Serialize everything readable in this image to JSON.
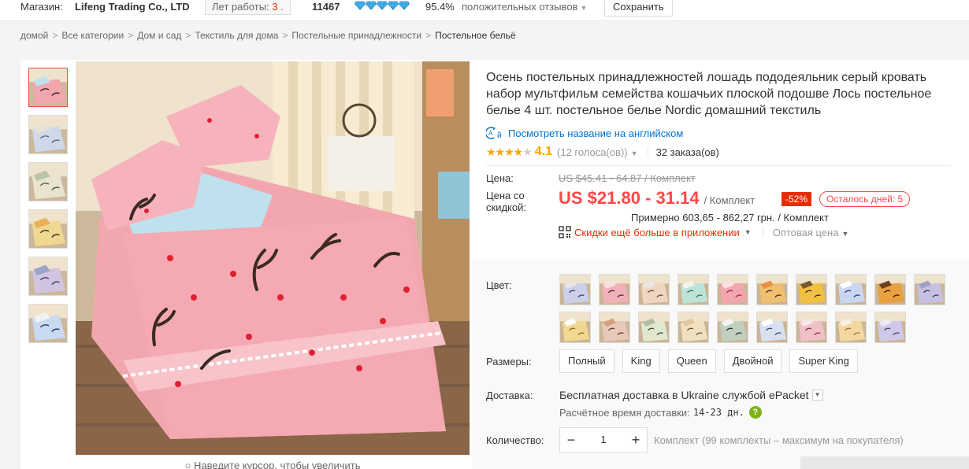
{
  "store": {
    "label": "Магазин:",
    "name": "Lifeng Trading Co., LTD",
    "years_label": "Лет работы:",
    "years_value": "3 .",
    "score": "11467",
    "diamond_count": 5,
    "positive_pct": "95.4%",
    "feedback_label": "положительных отзывов",
    "save_button": "Сохранить"
  },
  "breadcrumb": [
    "домой",
    "Все категории",
    "Дом и сад",
    "Текстиль для дома",
    "Постельные принадлежности",
    "Постельное бельё"
  ],
  "gallery": {
    "thumb_count": 6,
    "zoom_hint": "Наведите курсор, чтобы увеличить"
  },
  "product": {
    "title": "Осень постельных принадлежностей лошадь пододеяльник серый кровать набор мультфильм семейства кошачьих плоской подошве Лось постельное белье 4 шт. постельное белье Nordic домашний текстиль",
    "english_link": "Посмотреть название на английском",
    "rating": {
      "stars": "★★★★",
      "stars_empty": "★",
      "value": "4.1",
      "votes": "(12 голоса(ов))",
      "orders": "32 заказа(ов)"
    }
  },
  "price": {
    "label": "Цена:",
    "old": "US $45.41 - 64.87 / Комплект",
    "discount_label_1": "Цена со",
    "discount_label_2": "скидкой:",
    "new": "US $21.80 - 31.14",
    "unit": "/ Комплект",
    "discount_badge": "-52%",
    "days_left": "Осталось дней: 5",
    "approx": "Примерно 603,65 - 862,27 грн. / Комплект",
    "app_promo": "Скидки ещё больше в приложении",
    "wholesale": "Оптовая цена"
  },
  "options": {
    "color_label": "Цвет:",
    "color_swatches": 19,
    "size_label": "Размеры:",
    "sizes": [
      "Полный",
      "King",
      "Queen",
      "Двойной",
      "Super King"
    ]
  },
  "shipping": {
    "label": "Доставка:",
    "text_bold": "Бесплатная доставка в",
    "country": "Ukraine",
    "service": "службой ePacket",
    "eta_label": "Расчётное время доставки:",
    "eta_days": "14-23 дн."
  },
  "quantity": {
    "label": "Количество:",
    "minus": "−",
    "value": "1",
    "plus": "+",
    "note": "Комплект (99 комплекты – максимум на покупателя)"
  },
  "colors": {
    "accent": "#ff4747",
    "discount": "#e62e04",
    "link": "#0073cf",
    "star": "#ffa300"
  }
}
